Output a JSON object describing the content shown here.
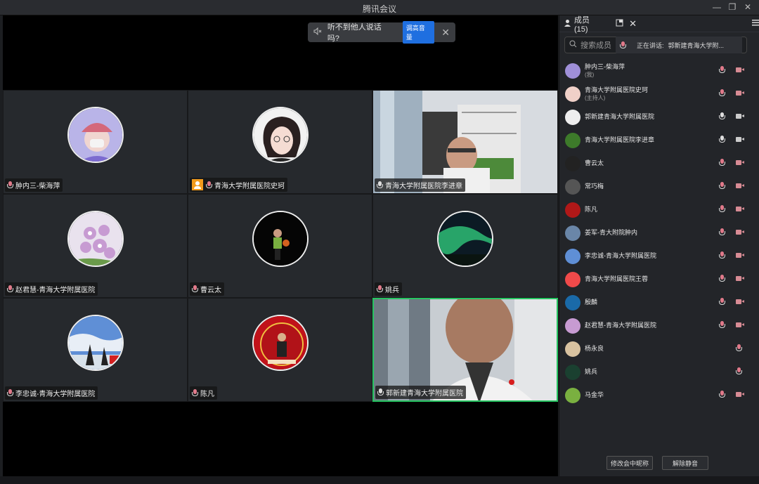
{
  "window": {
    "title": "腾讯会议",
    "minimize": "—",
    "maximize": "❐",
    "close": "✕"
  },
  "notice": {
    "text": "听不到他人说话吗?",
    "button": "调高音量",
    "close": "✕"
  },
  "tiles": [
    {
      "label": "肿内三-柴海萍"
    },
    {
      "label": "青海大学附属医院史珂"
    },
    {
      "label": "青海大学附属医院李进章"
    },
    {
      "label": "赵君慧-青海大学附属医院"
    },
    {
      "label": "曹云太"
    },
    {
      "label": "姚兵"
    },
    {
      "label": "李忠诚-青海大学附属医院"
    },
    {
      "label": "陈凡"
    },
    {
      "label": "郭新建青海大学附属医院"
    }
  ],
  "panel": {
    "tab_label": "成员(15)",
    "search_placeholder": "搜索成员",
    "speaking_prefix": "正在讲话:",
    "speaking_name": "郭新建青海大学附...",
    "members": [
      {
        "name": "肿内三-柴海萍",
        "sub": "(我)"
      },
      {
        "name": "青海大学附属医院史珂",
        "sub": "(主持人)"
      },
      {
        "name": "郭新建青海大学附属医院",
        "sub": ""
      },
      {
        "name": "青海大学附属医院李进章",
        "sub": ""
      },
      {
        "name": "曹云太",
        "sub": ""
      },
      {
        "name": "常巧梅",
        "sub": ""
      },
      {
        "name": "陈凡",
        "sub": ""
      },
      {
        "name": "姜军-青大附院肿内",
        "sub": ""
      },
      {
        "name": "李忠诚-青海大学附属医院",
        "sub": ""
      },
      {
        "name": "青海大学附属医院王蓉",
        "sub": ""
      },
      {
        "name": "殷麟",
        "sub": ""
      },
      {
        "name": "赵君慧-青海大学附属医院",
        "sub": ""
      },
      {
        "name": "杨永良",
        "sub": ""
      },
      {
        "name": "姚兵",
        "sub": ""
      },
      {
        "name": "马金华",
        "sub": ""
      }
    ],
    "rename_button": "修改会中昵称",
    "unmute_button": "解除静音"
  },
  "colors": {
    "accent": "#1f6fe0",
    "active_speaker": "#26c461",
    "muted": "#e07a8a"
  }
}
